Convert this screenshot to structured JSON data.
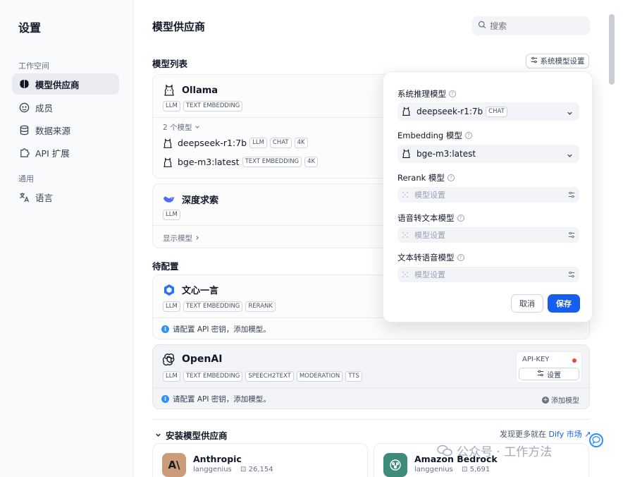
{
  "sidebar": {
    "title": "设置",
    "groups": [
      {
        "label": "工作空间",
        "items": [
          {
            "label": "模型供应商",
            "icon": "brain-icon",
            "active": true
          },
          {
            "label": "成员",
            "icon": "members-icon"
          },
          {
            "label": "数据来源",
            "icon": "database-icon"
          },
          {
            "label": "API 扩展",
            "icon": "puzzle-icon"
          }
        ]
      },
      {
        "label": "通用",
        "items": [
          {
            "label": "语言",
            "icon": "translate-icon"
          }
        ]
      }
    ]
  },
  "main": {
    "title": "模型供应商",
    "search_placeholder": "搜索",
    "model_list_title": "模型列表",
    "system_settings_label": "系统模型设置",
    "providers": [
      {
        "name": "Ollama",
        "tags": [
          "LLM",
          "TEXT EMBEDDING"
        ],
        "models_toggle": "2 个模型",
        "models": [
          {
            "name": "deepseek-r1:7b",
            "tags": [
              "LLM",
              "CHAT",
              "4K"
            ]
          },
          {
            "name": "bge-m3:latest",
            "tags": [
              "TEXT EMBEDDING",
              "4K"
            ]
          }
        ]
      },
      {
        "name": "深度求索",
        "tags": [
          "LLM"
        ],
        "show_models": "显示模型"
      }
    ],
    "pending_title": "待配置",
    "pending": [
      {
        "name": "文心一言",
        "tags": [
          "LLM",
          "TEXT EMBEDDING",
          "RERANK"
        ],
        "note": "请配置 API 密钥，添加模型。"
      },
      {
        "name": "OpenAI",
        "tags": [
          "LLM",
          "TEXT EMBEDDING",
          "SPEECH2TEXT",
          "MODERATION",
          "TTS"
        ],
        "note": "请配置 API 密钥，添加模型。",
        "api_key_label": "API-KEY",
        "settings_label": "设置",
        "add_model_label": "添加模型"
      }
    ],
    "install_title": "安装模型供应商",
    "discover_prefix": "发现更多就在",
    "discover_link": "Dify 市场",
    "marketplace": [
      {
        "name": "Anthropic",
        "author": "langgenius",
        "downloads": "26,154",
        "logo_text": "A\\",
        "logo_bg": "#cc9b7a"
      },
      {
        "name": "Amazon Bedrock",
        "author": "langgenius",
        "downloads": "5,691",
        "logo_text": "",
        "logo_bg": "#3d8c7a"
      }
    ]
  },
  "popup": {
    "fields": [
      {
        "label": "系统推理模型",
        "value": "deepseek-r1:7b",
        "tag": "CHAT"
      },
      {
        "label": "Embedding 模型",
        "value": "bge-m3:latest"
      },
      {
        "label": "Rerank 模型",
        "placeholder": "模型设置"
      },
      {
        "label": "语音转文本模型",
        "placeholder": "模型设置"
      },
      {
        "label": "文本转语音模型",
        "placeholder": "模型设置"
      }
    ],
    "cancel": "取消",
    "save": "保存"
  },
  "watermark": "公众号 · 工作方法",
  "colors": {
    "primary": "#155eef",
    "danger": "#f04438",
    "info": "#2e90fa",
    "sidebar_bg": "#f9fafb"
  }
}
